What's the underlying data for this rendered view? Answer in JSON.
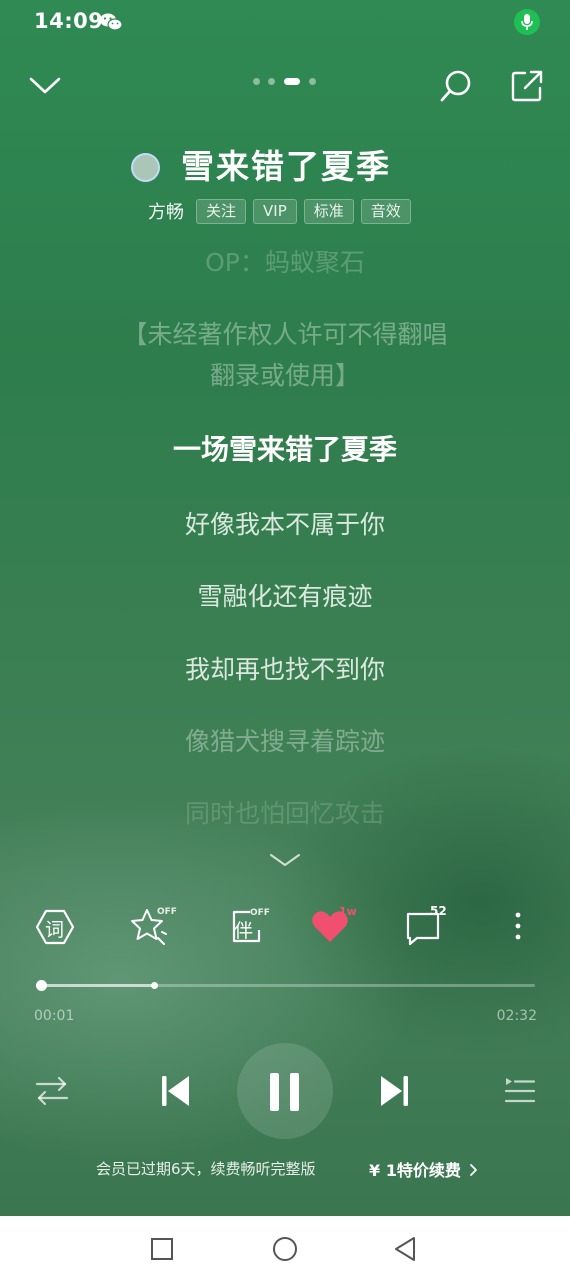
{
  "status_bar": {
    "time": "14:09",
    "icons": [
      "wechat-icon",
      "mic-icon"
    ],
    "mic_color": "#1fbf55"
  },
  "header": {
    "icons": [
      "chevron-down-icon",
      "search-icon",
      "share-icon"
    ],
    "pages": 4,
    "active_page": 3
  },
  "song": {
    "title": "雪来错了夏季",
    "artist": "方畅",
    "tags": [
      "关注",
      "VIP",
      "标准",
      "音效"
    ]
  },
  "lyrics": [
    "OP：蚂蚁聚石",
    "【未经著作权人许可不得翻唱",
    "翻录或使用】",
    "一场雪来错了夏季",
    "好像我本不属于你",
    "雪融化还有痕迹",
    "我却再也找不到你",
    "像猎犬搜寻着踪迹",
    "同时也怕回忆攻击"
  ],
  "current_lyric_index": 3,
  "actions": {
    "lyrics_label": "词",
    "star_badge": "OFF",
    "accompany_label": "伴",
    "accompany_badge": "OFF",
    "like_count": "1w",
    "comment_count": "52",
    "like_color": "#f0506e"
  },
  "player": {
    "current_time": "00:01",
    "total_time": "02:32",
    "progress_fraction": 0.007,
    "buffer_fraction": 0.233,
    "state": "playing"
  },
  "vip_bar": {
    "message": "会员已过期6天，续费畅听完整版",
    "cta": "¥ 1特价续费",
    "cta_icon": "chevron-right-icon"
  },
  "nav_bar": {
    "icons": [
      "recents-square-icon",
      "home-circle-icon",
      "back-triangle-icon"
    ]
  }
}
